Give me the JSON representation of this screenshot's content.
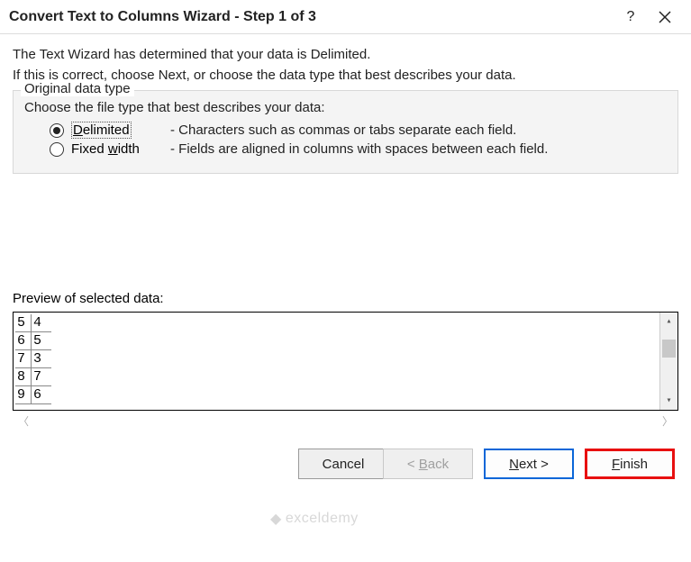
{
  "title": "Convert Text to Columns Wizard - Step 1 of 3",
  "intro": {
    "line1": "The Text Wizard has determined that your data is Delimited.",
    "line2": "If this is correct, choose Next, or choose the data type that best describes your data."
  },
  "fieldset": {
    "legend": "Original data type",
    "prompt": "Choose the file type that best describes your data:",
    "options": [
      {
        "selected": true,
        "accel": "D",
        "label_rest": "elimited",
        "desc": "- Characters such as commas or tabs separate each field."
      },
      {
        "selected": false,
        "label_pre": "Fixed ",
        "accel": "w",
        "label_rest": "idth",
        "desc": "- Fields are aligned in columns with spaces between each field."
      }
    ]
  },
  "preview": {
    "label": "Preview of selected data:",
    "rows": [
      {
        "a": "5",
        "b": "4"
      },
      {
        "a": "6",
        "b": "5"
      },
      {
        "a": "7",
        "b": "3"
      },
      {
        "a": "8",
        "b": "7"
      },
      {
        "a": "9",
        "b": "6"
      }
    ]
  },
  "buttons": {
    "cancel": "Cancel",
    "back_pre": "< ",
    "back_accel": "B",
    "back_rest": "ack",
    "next_accel": "N",
    "next_rest": "ext >",
    "finish_accel": "F",
    "finish_rest": "inish"
  },
  "watermark": "exceldemy"
}
